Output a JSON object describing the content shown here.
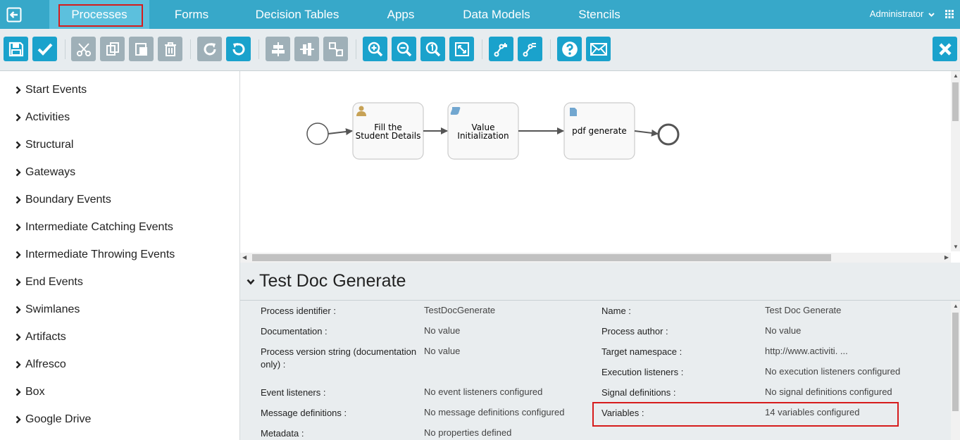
{
  "nav": {
    "tabs": [
      {
        "label": "Processes"
      },
      {
        "label": "Forms"
      },
      {
        "label": "Decision Tables"
      },
      {
        "label": "Apps"
      },
      {
        "label": "Data Models"
      },
      {
        "label": "Stencils"
      }
    ],
    "user": "Administrator",
    "back_icon": "back-icon",
    "grid_icon": "grid-icon"
  },
  "toolbar": {
    "buttons": [
      "save",
      "validate",
      "cut",
      "copy",
      "paste",
      "delete",
      "redo",
      "undo",
      "align-horizontal",
      "align-vertical",
      "same-size",
      "zoom-in",
      "zoom-out",
      "zoom-actual",
      "zoom-fit",
      "bendpoint-add",
      "bendpoint-remove",
      "help",
      "feedback",
      "close"
    ]
  },
  "palette": {
    "items": [
      {
        "label": "Start Events"
      },
      {
        "label": "Activities"
      },
      {
        "label": "Structural"
      },
      {
        "label": "Gateways"
      },
      {
        "label": "Boundary Events"
      },
      {
        "label": "Intermediate Catching Events"
      },
      {
        "label": "Intermediate Throwing Events"
      },
      {
        "label": "End Events"
      },
      {
        "label": "Swimlanes"
      },
      {
        "label": "Artifacts"
      },
      {
        "label": "Alfresco"
      },
      {
        "label": "Box"
      },
      {
        "label": "Google Drive"
      }
    ]
  },
  "diagram": {
    "tasks": [
      {
        "line1": "Fill the",
        "line2": "Student Details",
        "icon": "user-task-icon"
      },
      {
        "line1": "Value",
        "line2": "Initialization",
        "icon": "script-task-icon"
      },
      {
        "line1": "pdf generate",
        "line2": "",
        "icon": "document-task-icon"
      }
    ]
  },
  "properties": {
    "title": "Test Doc Generate",
    "left": [
      {
        "label": "Process identifier :",
        "value": "TestDocGenerate"
      },
      {
        "label": "Documentation :",
        "value": "No value"
      },
      {
        "label": "Process version string (documentation only) :",
        "value": "No value"
      },
      {
        "label": "Event listeners :",
        "value": "No event listeners configured"
      },
      {
        "label": "Message definitions :",
        "value": "No message definitions configured"
      },
      {
        "label": "Metadata :",
        "value": "No properties defined"
      }
    ],
    "right": [
      {
        "label": "Name :",
        "value": "Test Doc Generate"
      },
      {
        "label": "Process author :",
        "value": "No value"
      },
      {
        "label": "Target namespace :",
        "value": "http://www.activiti. ..."
      },
      {
        "label": "Execution listeners :",
        "value": "No execution listeners configured"
      },
      {
        "label": "Signal definitions :",
        "value": "No signal definitions configured"
      },
      {
        "label": "Variables :",
        "value": "14 variables configured"
      }
    ]
  },
  "colors": {
    "nav_bg": "#37a8c9",
    "toolbar_btn_blue": "#1aa2cc",
    "toolbar_btn_gray": "#9fb0b8",
    "highlight_red": "#d61c1c"
  }
}
